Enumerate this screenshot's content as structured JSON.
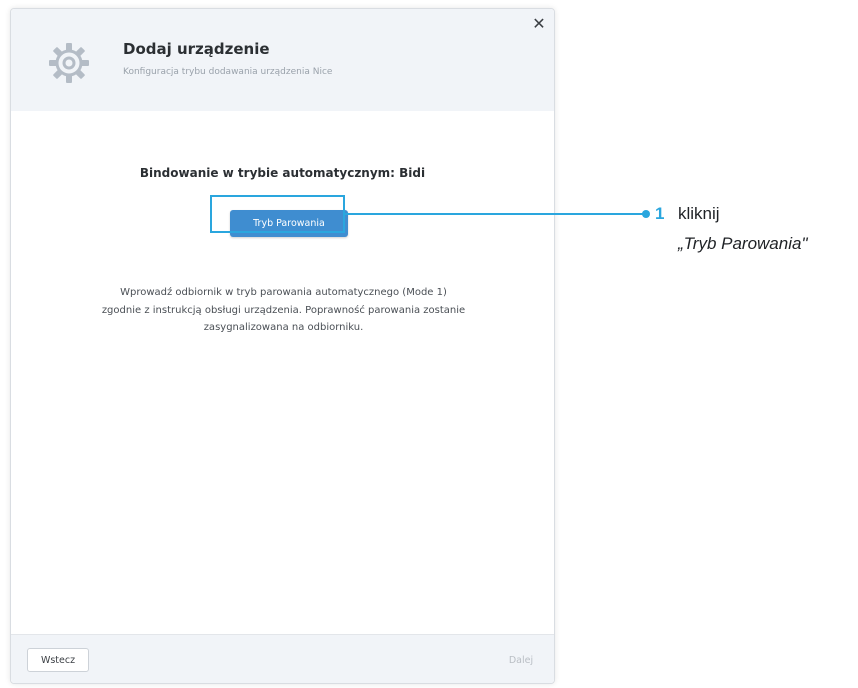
{
  "dialog": {
    "title": "Dodaj urządzenie",
    "subtitle": "Konfiguracja trybu dodawania urządzenia Nice",
    "header_icon": "gear-icon",
    "close_label": "✕",
    "section_title": "Bindowanie w trybie automatycznym: Bidi",
    "pair_button_label": "Tryb Parowania",
    "instructions": "Wprowadź odbiornik w tryb parowania automatycznego (Mode 1) zgodnie z instrukcją obsługi urządzenia. Poprawność parowania zostanie zasygnalizowana na odbiorniku.",
    "footer": {
      "back_label": "Wstecz",
      "next_label": "Dalej",
      "next_enabled": false
    }
  },
  "callout": {
    "number": "1",
    "text": "kliknij",
    "target": "„Tryb Parowania\""
  },
  "colors": {
    "accent": "#2aa6de",
    "button_blue": "#3f8dd0",
    "header_bg": "#f1f4f8"
  }
}
